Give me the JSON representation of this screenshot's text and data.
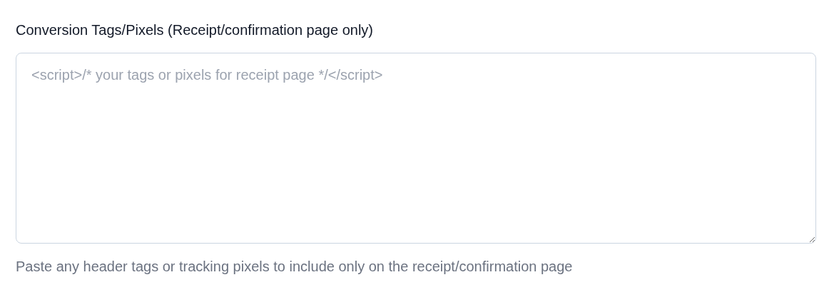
{
  "field": {
    "label": "Conversion Tags/Pixels (Receipt/confirmation page only)",
    "placeholder": "<script>/* your tags or pixels for receipt page */</script>",
    "help_text": "Paste any header tags or tracking pixels to include only on the receipt/confirmation page"
  }
}
